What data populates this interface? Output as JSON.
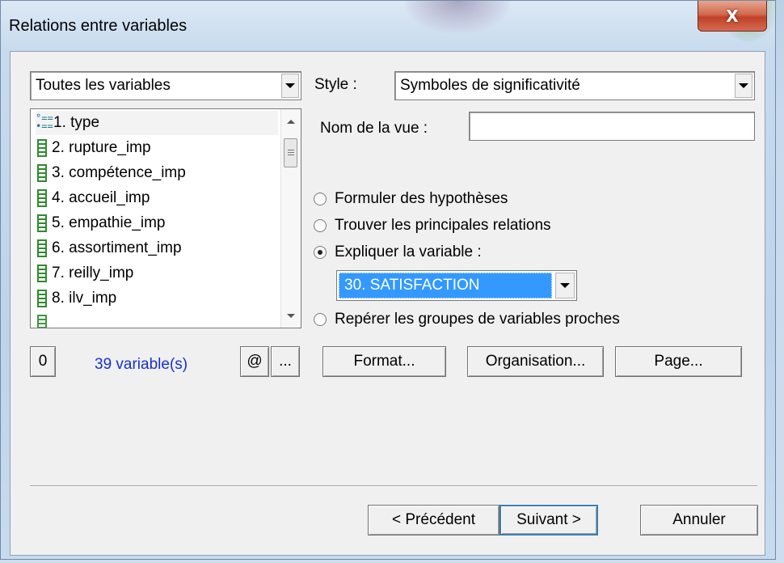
{
  "window": {
    "title": "Relations entre variables",
    "close_label": "X"
  },
  "left": {
    "filter_combo": "Toutes les variables",
    "variables": [
      {
        "label": "1. type",
        "icon": "categorical-icon"
      },
      {
        "label": "2. rupture_imp",
        "icon": "numeric-icon"
      },
      {
        "label": "3. compétence_imp",
        "icon": "numeric-icon"
      },
      {
        "label": "4. accueil_imp",
        "icon": "numeric-icon"
      },
      {
        "label": "5. empathie_imp",
        "icon": "numeric-icon"
      },
      {
        "label": "6. assortiment_imp",
        "icon": "numeric-icon"
      },
      {
        "label": "7. reilly_imp",
        "icon": "numeric-icon"
      },
      {
        "label": "8. ilv_imp",
        "icon": "numeric-icon"
      }
    ],
    "zero_button": "0",
    "count_label": "39 variable(s)",
    "at_button": "@",
    "more_button": "..."
  },
  "right": {
    "style_label": "Style :",
    "style_value": "Symboles de significativité",
    "view_name_label": "Nom de la vue :",
    "view_name_value": "",
    "options": [
      {
        "label": "Formuler des hypothèses",
        "checked": false
      },
      {
        "label": "Trouver les principales relations",
        "checked": false
      },
      {
        "label": "Expliquer la variable :",
        "checked": true
      },
      {
        "label": "Repérer les groupes de variables proches",
        "checked": false
      }
    ],
    "explained_variable": "30. SATISFACTION",
    "format_button": "Format...",
    "organisation_button": "Organisation...",
    "page_button": "Page..."
  },
  "footer": {
    "prev_button": "< Précédent",
    "next_button": "Suivant >",
    "cancel_button": "Annuler"
  }
}
